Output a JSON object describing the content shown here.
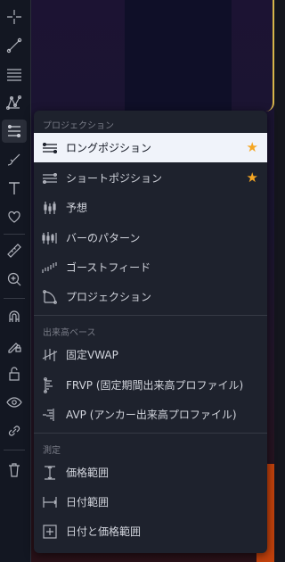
{
  "menu": {
    "sections": [
      {
        "title": "プロジェクション",
        "items": [
          {
            "label": "ロングポジション",
            "icon": "long-position-icon",
            "favorite": true,
            "selected": true
          },
          {
            "label": "ショートポジション",
            "icon": "short-position-icon",
            "favorite": true,
            "selected": false
          },
          {
            "label": "予想",
            "icon": "forecast-icon",
            "favorite": false,
            "selected": false
          },
          {
            "label": "バーのパターン",
            "icon": "bars-pattern-icon",
            "favorite": false,
            "selected": false
          },
          {
            "label": "ゴーストフィード",
            "icon": "ghost-feed-icon",
            "favorite": false,
            "selected": false
          },
          {
            "label": "プロジェクション",
            "icon": "projection-icon",
            "favorite": false,
            "selected": false
          }
        ]
      },
      {
        "title": "出来高ベース",
        "items": [
          {
            "label": "固定VWAP",
            "icon": "anchored-vwap-icon",
            "favorite": false,
            "selected": false
          },
          {
            "label": "FRVP (固定期間出来高プロファイル)",
            "icon": "frvp-icon",
            "favorite": false,
            "selected": false
          },
          {
            "label": "AVP (アンカー出来高プロファイル)",
            "icon": "avp-icon",
            "favorite": false,
            "selected": false
          }
        ]
      },
      {
        "title": "測定",
        "items": [
          {
            "label": "価格範囲",
            "icon": "price-range-icon",
            "favorite": false,
            "selected": false
          },
          {
            "label": "日付範囲",
            "icon": "date-range-icon",
            "favorite": false,
            "selected": false
          },
          {
            "label": "日付と価格範囲",
            "icon": "date-price-range-icon",
            "favorite": false,
            "selected": false
          }
        ]
      }
    ]
  },
  "toolbar": {
    "tools": [
      "crosshair-icon",
      "trend-line-icon",
      "fib-retracement-icon",
      "pattern-icon",
      "prediction-measurement-icon",
      "brush-icon",
      "text-icon",
      "heart-icon",
      "ruler-icon",
      "zoom-in-icon",
      "magnet-icon",
      "lock-drawing-icon",
      "lock-icon",
      "eye-icon",
      "link-icon",
      "trash-icon"
    ]
  },
  "colors": {
    "menu_bg": "#1e222d",
    "selected_bg": "#f0f3fa",
    "star": "#f5a623",
    "section_title": "#787b86"
  }
}
